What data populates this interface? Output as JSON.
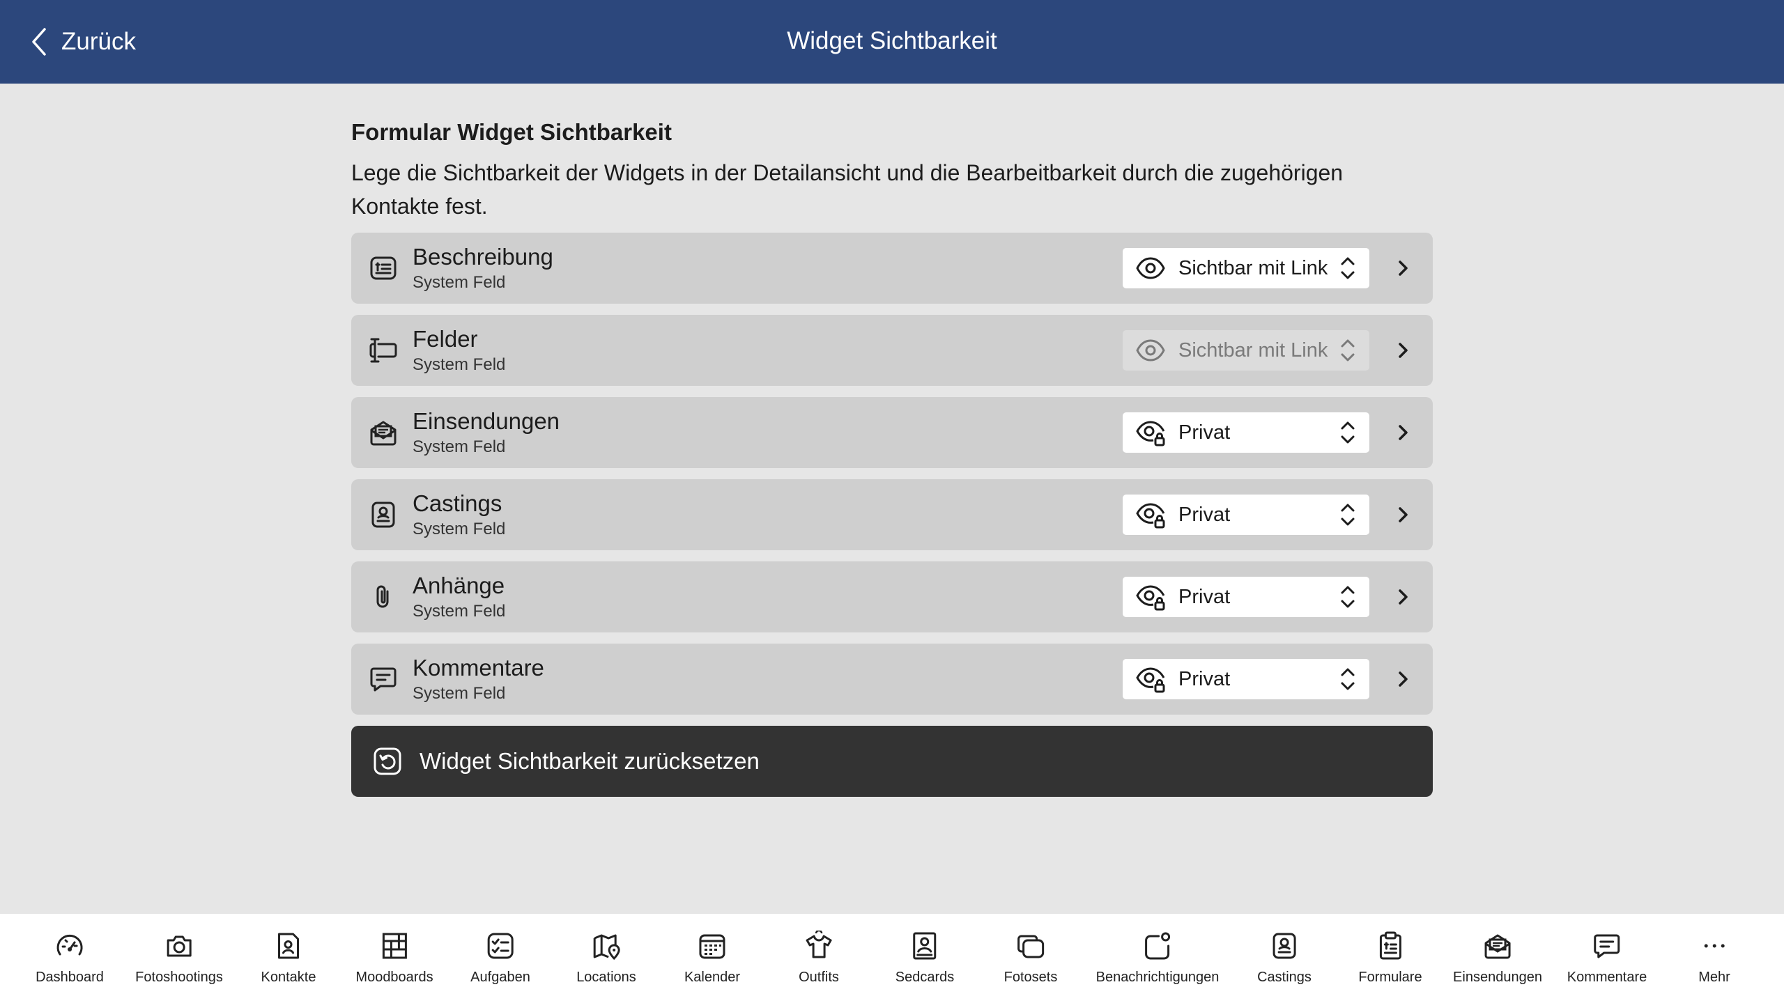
{
  "header": {
    "back_label": "Zurück",
    "title": "Widget Sichtbarkeit"
  },
  "section": {
    "title": "Formular Widget Sichtbarkeit",
    "description": "Lege die Sichtbarkeit der Widgets in der Detailansicht und die Bearbeitbarkeit durch die zugehörigen Kontakte fest."
  },
  "widgets": [
    {
      "name": "Beschreibung",
      "subtitle": "System Feld",
      "icon": "description-icon",
      "visibility": "Sichtbar mit Link",
      "visibility_icon": "eye-icon",
      "enabled": true
    },
    {
      "name": "Felder",
      "subtitle": "System Feld",
      "icon": "input-field-icon",
      "visibility": "Sichtbar mit Link",
      "visibility_icon": "eye-icon",
      "enabled": false
    },
    {
      "name": "Einsendungen",
      "subtitle": "System Feld",
      "icon": "envelope-open-icon",
      "visibility": "Privat",
      "visibility_icon": "eye-lock-icon",
      "enabled": true
    },
    {
      "name": "Castings",
      "subtitle": "System Feld",
      "icon": "casting-card-icon",
      "visibility": "Privat",
      "visibility_icon": "eye-lock-icon",
      "enabled": true
    },
    {
      "name": "Anhänge",
      "subtitle": "System Feld",
      "icon": "paperclip-icon",
      "visibility": "Privat",
      "visibility_icon": "eye-lock-icon",
      "enabled": true
    },
    {
      "name": "Kommentare",
      "subtitle": "System Feld",
      "icon": "comment-icon",
      "visibility": "Privat",
      "visibility_icon": "eye-lock-icon",
      "enabled": true
    }
  ],
  "reset_button": {
    "label": "Widget Sichtbarkeit zurücksetzen",
    "icon": "reset-icon"
  },
  "tabbar": [
    {
      "label": "Dashboard",
      "icon": "gauge-icon"
    },
    {
      "label": "Fotoshootings",
      "icon": "camera-icon"
    },
    {
      "label": "Kontakte",
      "icon": "contact-icon"
    },
    {
      "label": "Moodboards",
      "icon": "moodboard-icon"
    },
    {
      "label": "Aufgaben",
      "icon": "checklist-icon"
    },
    {
      "label": "Locations",
      "icon": "map-pin-icon"
    },
    {
      "label": "Kalender",
      "icon": "calendar-icon"
    },
    {
      "label": "Outfits",
      "icon": "shirt-icon"
    },
    {
      "label": "Sedcards",
      "icon": "sedcard-icon"
    },
    {
      "label": "Fotosets",
      "icon": "photoset-icon"
    },
    {
      "label": "Benachrichtigungen",
      "icon": "notification-icon"
    },
    {
      "label": "Castings",
      "icon": "casting-card-icon"
    },
    {
      "label": "Formulare",
      "icon": "clipboard-icon"
    },
    {
      "label": "Einsendungen",
      "icon": "envelope-open-icon"
    },
    {
      "label": "Kommentare",
      "icon": "comment-icon"
    },
    {
      "label": "Mehr",
      "icon": "more-icon"
    }
  ]
}
